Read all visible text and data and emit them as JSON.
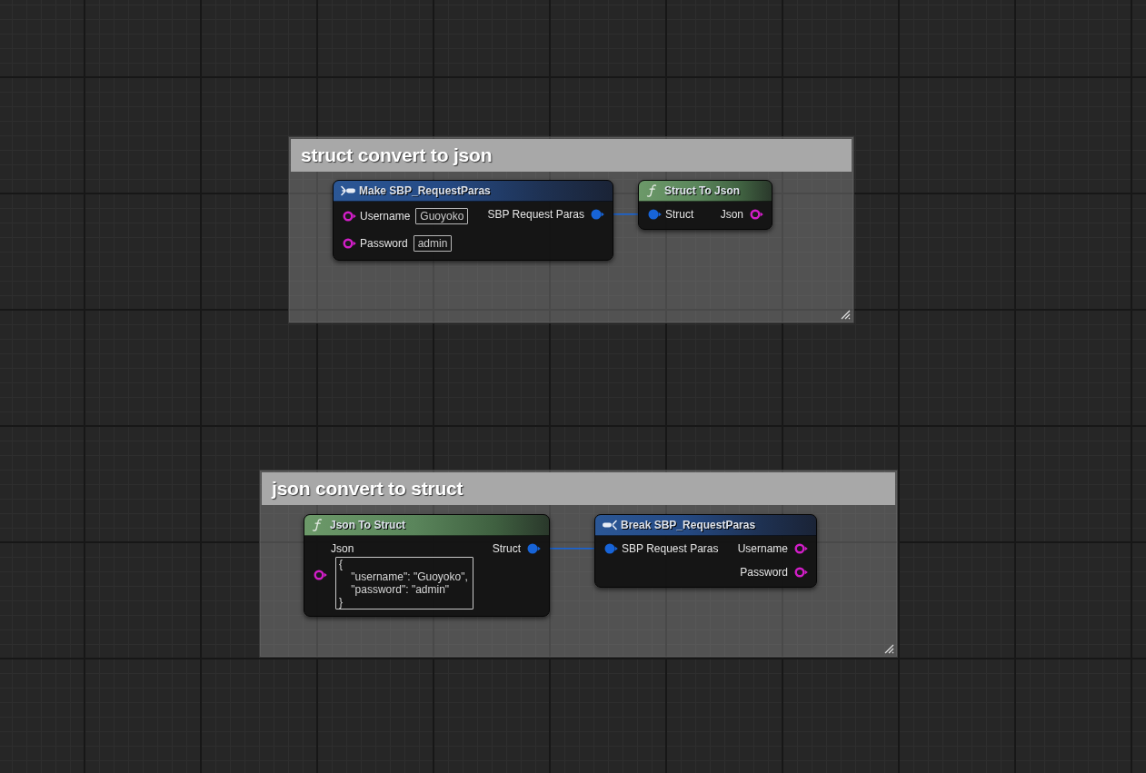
{
  "comments": [
    {
      "title": "struct convert to json",
      "nodes": [
        {
          "kind": "make",
          "title": "Make SBP_RequestParas",
          "inputs": [
            {
              "kind": "field",
              "color": "#d21ec8",
              "connected": false,
              "label": "Username",
              "value": "Guoyoko"
            },
            {
              "kind": "field",
              "color": "#d21ec8",
              "connected": false,
              "label": "Password",
              "value": "admin"
            }
          ],
          "outputs": [
            {
              "kind": "plain",
              "color": "#1764d8",
              "connected": true,
              "label": "SBP Request Paras"
            }
          ]
        },
        {
          "kind": "function",
          "title": "Struct To Json",
          "inputs": [
            {
              "kind": "plain",
              "color": "#1764d8",
              "connected": true,
              "label": "Struct"
            }
          ],
          "outputs": [
            {
              "kind": "plain",
              "color": "#d21ec8",
              "connected": false,
              "label": "Json"
            }
          ]
        }
      ]
    },
    {
      "title": "json convert to struct",
      "nodes": [
        {
          "kind": "function",
          "title": "Json To Struct",
          "inputs": [
            {
              "kind": "text_area",
              "color": "#d21ec8",
              "connected": false,
              "label": "Json",
              "value": "{\n    \"username\": \"Guoyoko\",\n    \"password\": \"admin\"\n}"
            }
          ],
          "outputs": [
            {
              "kind": "plain",
              "color": "#1764d8",
              "connected": true,
              "label": "Struct"
            }
          ]
        },
        {
          "kind": "break",
          "title": "Break SBP_RequestParas",
          "inputs": [
            {
              "kind": "plain",
              "color": "#1764d8",
              "connected": true,
              "label": "SBP Request Paras"
            }
          ],
          "outputs": [
            {
              "kind": "plain",
              "color": "#d21ec8",
              "connected": false,
              "label": "Username"
            },
            {
              "kind": "plain",
              "color": "#d21ec8",
              "connected": false,
              "label": "Password"
            }
          ]
        }
      ]
    }
  ]
}
